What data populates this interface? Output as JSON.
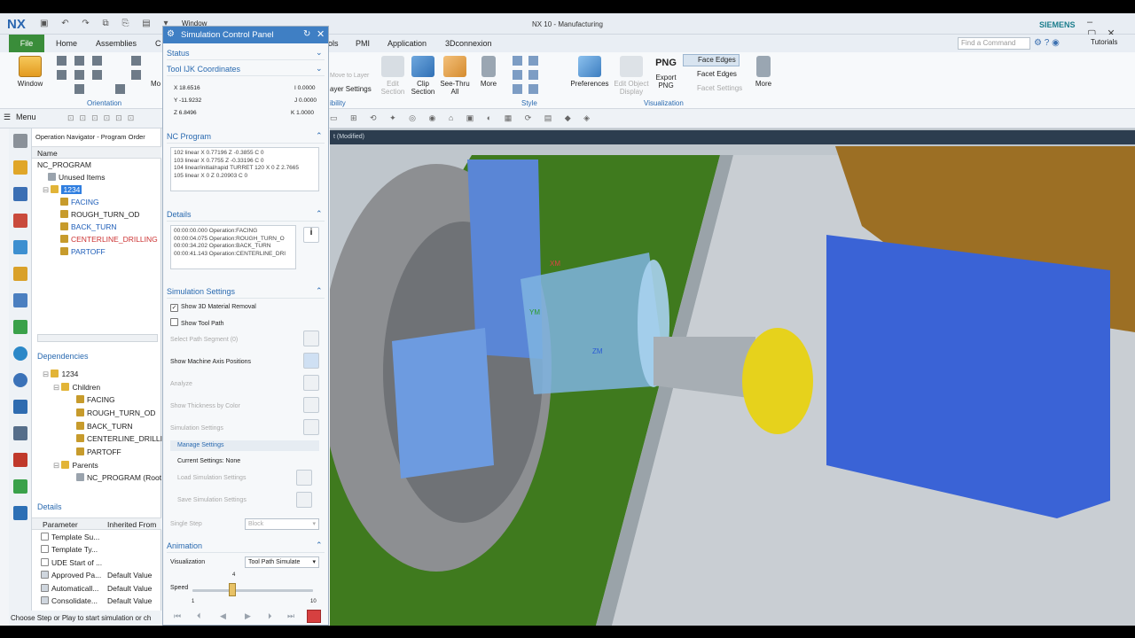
{
  "titlebar": {
    "logo": "NX",
    "window_menu": "Window",
    "title": "NX 10 - Manufacturing",
    "brand": "SIEMENS"
  },
  "tabs": [
    "File",
    "Home",
    "Assemblies",
    "C",
    "ols",
    "PMI",
    "Application",
    "3Dconnexion"
  ],
  "search": {
    "placeholder": "Find a Command"
  },
  "tutorials": "Tutorials",
  "ribbon": {
    "window_label": "Window",
    "mo_label": "Mo",
    "orientation_label": "Orientation",
    "move_to_layer": "Move to Layer",
    "layer_settings": "ayer Settings",
    "visibility": "ibility",
    "edit_section": "Edit Section",
    "clip_section": "Clip Section",
    "see_thru": "See-Thru All",
    "more1": "More",
    "style": "Style",
    "preferences": "Preferences",
    "edit_object_display": "Edit Object Display",
    "export_png": "Export PNG",
    "png": "PNG",
    "face_edges": "Face Edges",
    "facet_edges": "Facet Edges",
    "facet_settings": "Facet Settings",
    "more2": "More",
    "visualization": "Visualization"
  },
  "menu": "Menu",
  "navigator": {
    "title": "Operation Navigator - Program Order",
    "col_name": "Name",
    "root": "NC_PROGRAM",
    "unused": "Unused Items",
    "program": "1234",
    "ops": [
      "FACING",
      "ROUGH_TURN_OD",
      "BACK_TURN",
      "CENTERLINE_DRILLING",
      "PARTOFF"
    ],
    "dependencies": "Dependencies",
    "dep_program": "1234",
    "children": "Children",
    "dep_ops": [
      "FACING",
      "ROUGH_TURN_OD",
      "BACK_TURN",
      "CENTERLINE_DRILLIN",
      "PARTOFF"
    ],
    "parents": "Parents",
    "parent_item": "NC_PROGRAM (Root",
    "details": "Details",
    "detail_cols": [
      "Parameter",
      "Inherited From"
    ],
    "detail_rows": [
      [
        "Template Su...",
        ""
      ],
      [
        "Template Ty...",
        ""
      ],
      [
        "UDE Start of ...",
        ""
      ],
      [
        "Approved Pa...",
        "Default Value"
      ],
      [
        "Automaticall...",
        "Default Value"
      ],
      [
        "Consolidate...",
        "Default Value"
      ]
    ]
  },
  "status_text": "Choose Step or Play to start simulation or ch",
  "panel": {
    "title": "Simulation Control Panel",
    "status": "Status",
    "tool_coords": "Tool IJK Coordinates",
    "x": "X 18.6516",
    "y": "Y -11.9232",
    "z": "Z 6.8496",
    "i": "I 0.0000",
    "j": "J 0.0000",
    "k": "K 1.0000",
    "nc_program": "NC Program",
    "nc_lines": [
      "102 linear X 0.77196 Z -0.3855 C 0",
      "103 linear X 0.7755 Z -0.33196 C 0",
      "104 linear/initial/rapid TURRET 120 X 0 Z 2.7665",
      "105 linear X 0 Z 0.20903 C 0"
    ],
    "details": "Details",
    "detail_lines": [
      "00:00:00.000 Operation:FACING",
      "00:00:04.075 Operation:ROUGH_TURN_O",
      "00:00:34.202 Operation:BACK_TURN",
      "00:00:41.143 Operation:CENTERLINE_DRI"
    ],
    "sim_settings": "Simulation Settings",
    "show_3d": "Show 3D Material Removal",
    "show_tool_path": "Show Tool Path",
    "select_segment": "Select Path Segment (0)",
    "show_axis": "Show Machine Axis Positions",
    "analyze": "Analyze",
    "show_thickness": "Show Thickness by Color",
    "simulation_settings": "Simulation Settings",
    "manage": "Manage Settings",
    "current": "Current Settings: None",
    "load": "Load Simulation Settings",
    "save": "Save Simulation Settings",
    "single_step": "Single Step",
    "block": "Block",
    "animation": "Animation",
    "visualization": "Visualization",
    "vis_value": "Tool Path Simulate",
    "speed": "Speed",
    "speed_value": "4",
    "speed_min": "1",
    "speed_max": "10",
    "speed_fraction": 0.33
  },
  "viewport": {
    "tab": "t (Modified)",
    "axes": [
      "XM",
      "YM",
      "ZM"
    ]
  }
}
